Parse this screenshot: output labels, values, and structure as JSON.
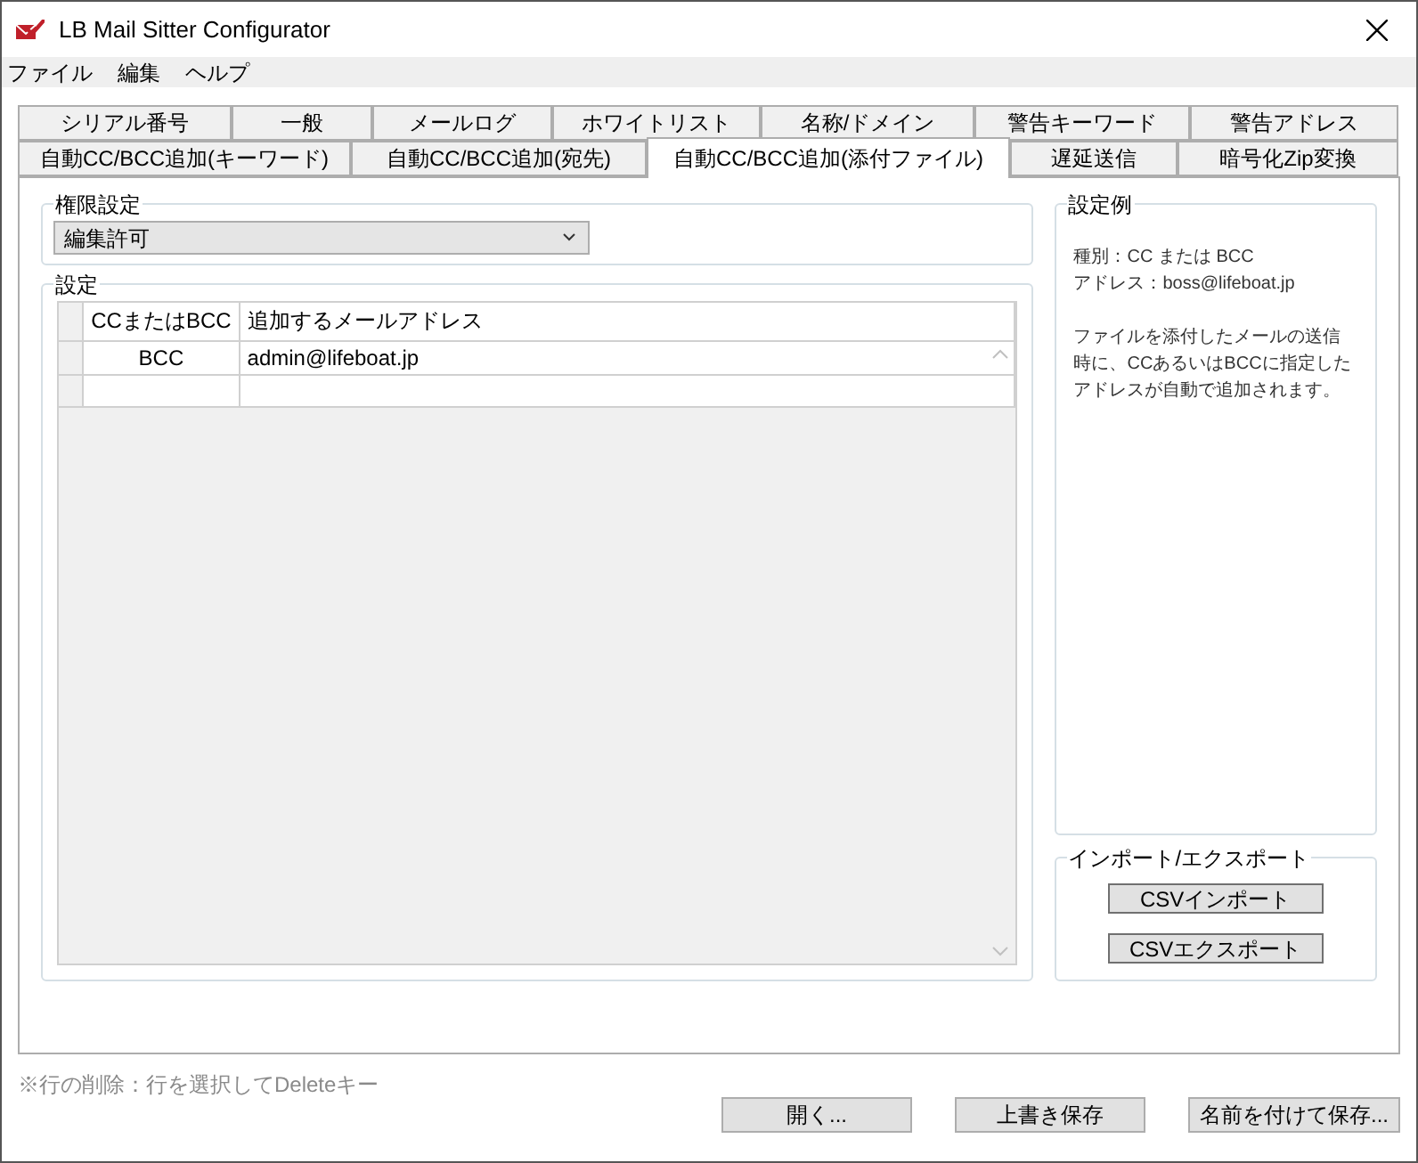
{
  "window": {
    "title": "LB Mail Sitter Configurator"
  },
  "menu": [
    "ファイル",
    "編集",
    "ヘルプ"
  ],
  "tab_rows": [
    [
      {
        "label": "シリアル番号",
        "selected": false
      },
      {
        "label": "一般",
        "selected": false
      },
      {
        "label": "メールログ",
        "selected": false
      },
      {
        "label": "ホワイトリスト",
        "selected": false
      },
      {
        "label": "名称/ドメイン",
        "selected": false
      },
      {
        "label": "警告キーワード",
        "selected": false
      },
      {
        "label": "警告アドレス",
        "selected": false
      }
    ],
    [
      {
        "label": "自動CC/BCC追加(キーワード)",
        "selected": false
      },
      {
        "label": "自動CC/BCC追加(宛先)",
        "selected": false
      },
      {
        "label": "自動CC/BCC追加(添付ファイル)",
        "selected": true
      },
      {
        "label": "遅延送信",
        "selected": false
      },
      {
        "label": "暗号化Zip変換",
        "selected": false
      }
    ]
  ],
  "permission": {
    "title": "権限設定",
    "value": "編集許可"
  },
  "settings": {
    "title": "設定",
    "columns": [
      "CCまたはBCC",
      "追加するメールアドレス"
    ],
    "rows": [
      [
        "BCC",
        "admin@lifeboat.jp"
      ]
    ]
  },
  "example": {
    "title": "設定例",
    "lines": [
      "種別：CC または BCC",
      "アドレス：boss@lifeboat.jp"
    ],
    "description": "ファイルを添付したメールの送信時に、CCあるいはBCCに指定したアドレスが自動で追加されます。"
  },
  "import_export": {
    "title": "インポート/エクスポート",
    "buttons": [
      "CSVインポート",
      "CSVエクスポート"
    ]
  },
  "hint": "※行の削除：行を選択してDeleteキー",
  "buttons": [
    "開く...",
    "上書き保存",
    "名前を付けて保存..."
  ]
}
